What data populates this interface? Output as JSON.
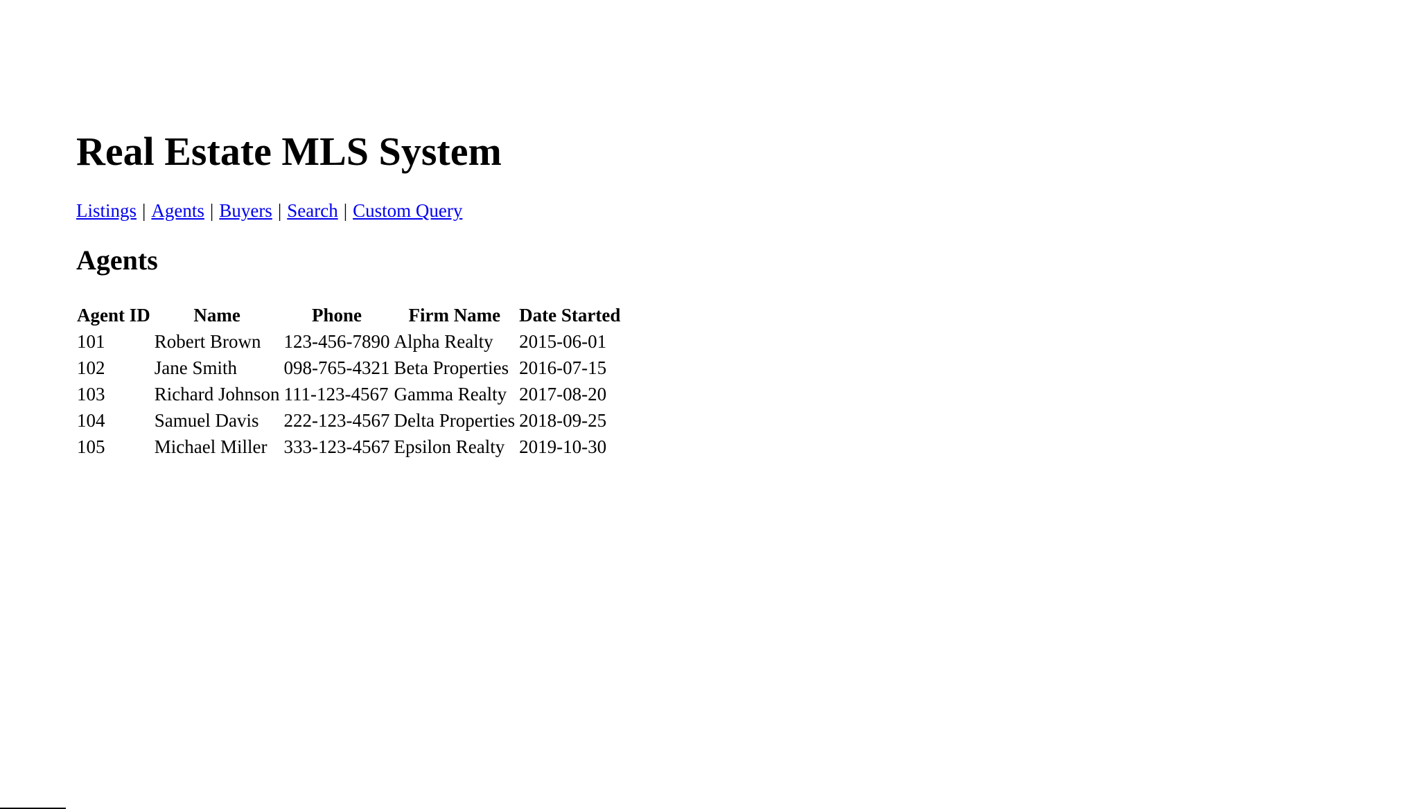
{
  "page": {
    "title": "Real Estate MLS System"
  },
  "nav": {
    "separator": "|",
    "links": [
      {
        "label": "Listings"
      },
      {
        "label": "Agents"
      },
      {
        "label": "Buyers"
      },
      {
        "label": "Search"
      },
      {
        "label": "Custom Query"
      }
    ]
  },
  "section": {
    "heading": "Agents"
  },
  "table": {
    "columns": [
      "Agent ID",
      "Name",
      "Phone",
      "Firm Name",
      "Date Started"
    ],
    "rows": [
      [
        "101",
        "Robert Brown",
        "123-456-7890",
        "Alpha Realty",
        "2015-06-01"
      ],
      [
        "102",
        "Jane Smith",
        "098-765-4321",
        "Beta Properties",
        "2016-07-15"
      ],
      [
        "103",
        "Richard Johnson",
        "111-123-4567",
        "Gamma Realty",
        "2017-08-20"
      ],
      [
        "104",
        "Samuel Davis",
        "222-123-4567",
        "Delta Properties",
        "2018-09-25"
      ],
      [
        "105",
        "Michael Miller",
        "333-123-4567",
        "Epsilon Realty",
        "2019-10-30"
      ]
    ]
  }
}
